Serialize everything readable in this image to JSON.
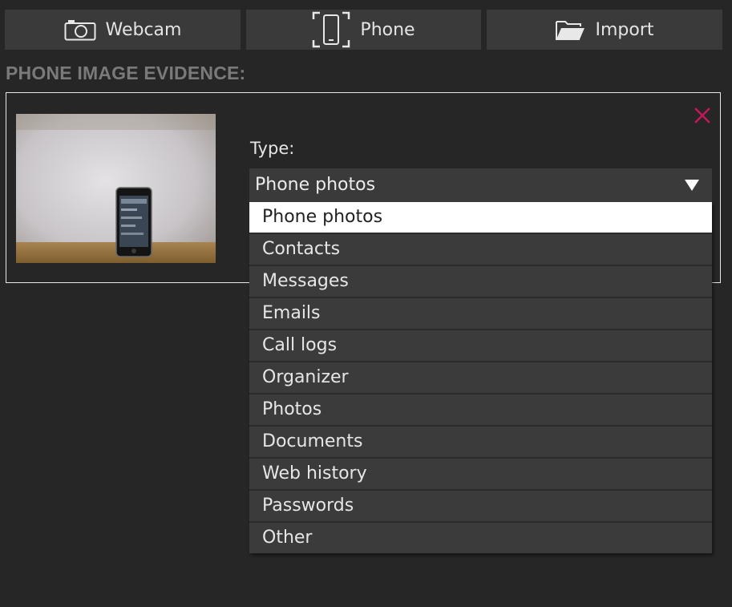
{
  "toolbar": {
    "webcam_label": "Webcam",
    "phone_label": "Phone",
    "import_label": "Import"
  },
  "section": {
    "title": "PHONE IMAGE EVIDENCE:"
  },
  "evidence": {
    "type_label": "Type:",
    "selected_type": "Phone photos"
  },
  "dropdown": {
    "options": [
      "Phone photos",
      "Contacts",
      "Messages",
      "Emails",
      "Call logs",
      "Organizer",
      "Photos",
      "Documents",
      "Web history",
      "Passwords",
      "Other"
    ],
    "selected_index": 0
  },
  "colors": {
    "background": "#262626",
    "button": "#3a3a3a",
    "close_accent": "#c2185b",
    "section_title": "#7a7a7a"
  },
  "icons": {
    "webcam": "camera-icon",
    "phone": "phone-icon",
    "import": "folder-icon",
    "close": "close-icon",
    "dropdown": "triangle-down-icon"
  }
}
